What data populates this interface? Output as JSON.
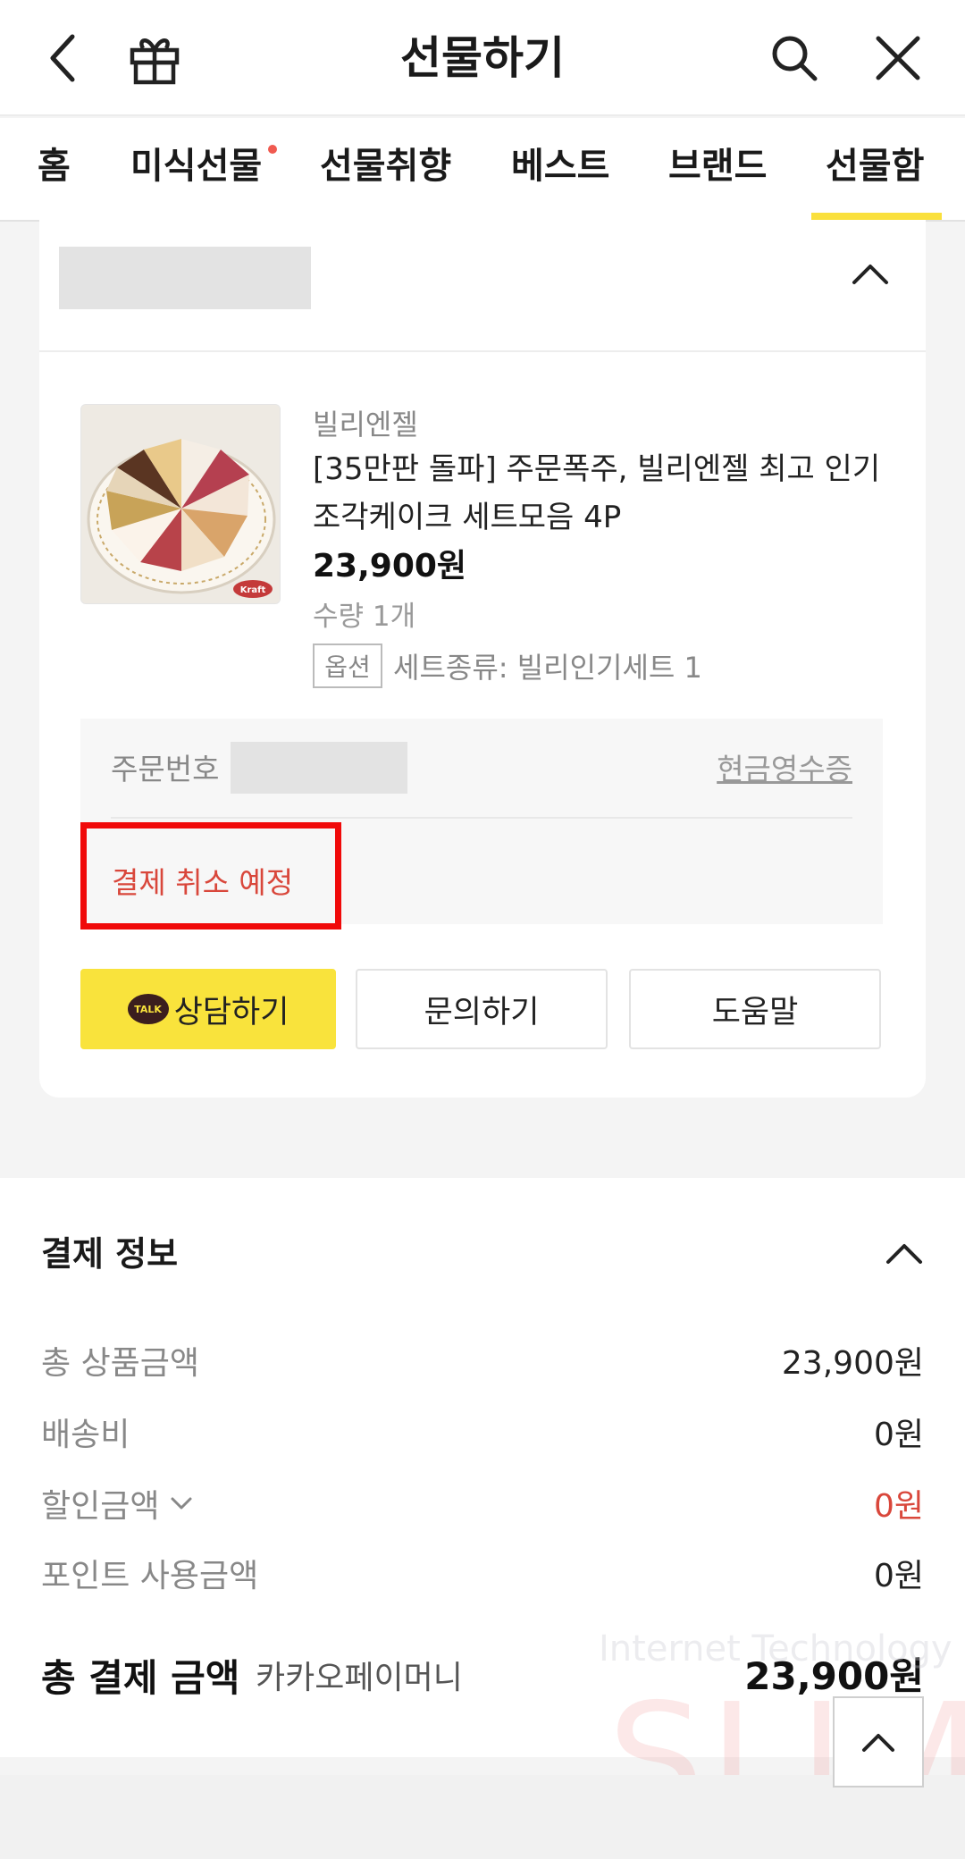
{
  "header": {
    "title": "선물하기"
  },
  "tabs": [
    {
      "label": "홈"
    },
    {
      "label": "미식선물"
    },
    {
      "label": "선물취향"
    },
    {
      "label": "베스트"
    },
    {
      "label": "브랜드"
    },
    {
      "label": "선물함"
    }
  ],
  "active_tab": "선물함",
  "product": {
    "brand": "빌리엔젤",
    "name": "[35만판 돌파] 주문폭주, 빌리엔젤 최고 인기 조각케이크 세트모음 4P",
    "price": "23,900원",
    "quantity": "수량 1개",
    "option_badge": "옵션",
    "option_text": "세트종류: 빌리인기세트 1",
    "image_label": "Kraft"
  },
  "order_info": {
    "order_number_label": "주문번호",
    "receipt_link": "현금영수증",
    "status": "결제 취소 예정"
  },
  "actions": {
    "talk_icon": "TALK",
    "consult": "상담하기",
    "inquiry": "문의하기",
    "help": "도움말"
  },
  "payment": {
    "title": "결제 정보",
    "rows": [
      {
        "label": "총 상품금액",
        "value": "23,900원"
      },
      {
        "label": "배송비",
        "value": "0원"
      },
      {
        "label": "할인금액",
        "value": "0원"
      },
      {
        "label": "포인트 사용금액",
        "value": "0원"
      }
    ],
    "total_label": "총 결제 금액",
    "method": "카카오페이머니",
    "total_value": "23,900원"
  },
  "watermark": {
    "line1": "Internet Technology",
    "line2": "SLIM"
  },
  "colors": {
    "accent_yellow": "#fae03c",
    "status_red": "#d9473b",
    "highlight_box": "#f00a0a"
  }
}
